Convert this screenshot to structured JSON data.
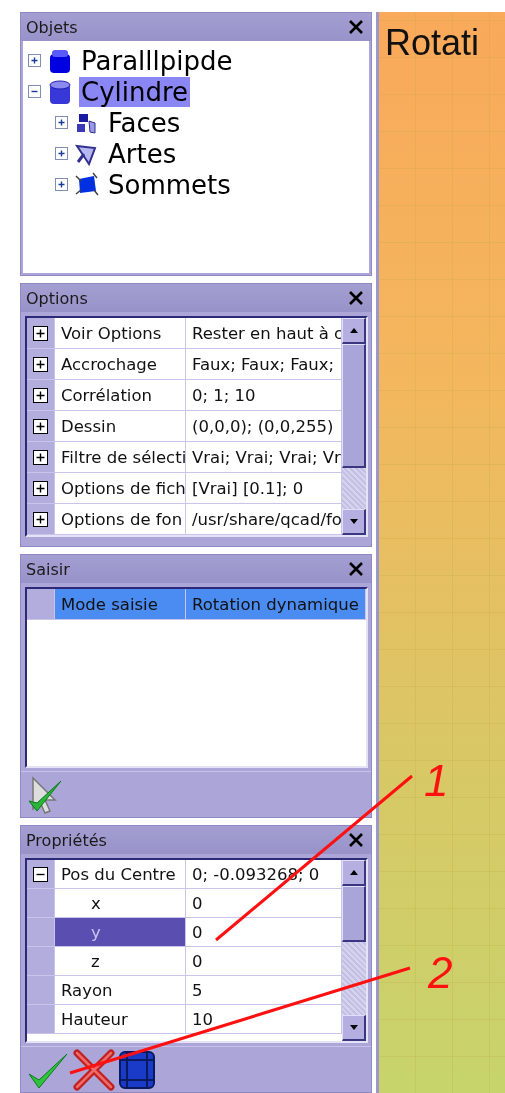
{
  "objects": {
    "title": "Objets",
    "tree": [
      {
        "label": "Paralllpipde",
        "kind": "box",
        "expanded": false,
        "selected": false
      },
      {
        "label": "Cylindre",
        "kind": "cylinder",
        "expanded": true,
        "selected": true,
        "children": [
          {
            "label": "Faces",
            "kind": "faces",
            "expanded": false,
            "selected": false
          },
          {
            "label": "Artes",
            "kind": "edges",
            "expanded": false,
            "selected": false
          },
          {
            "label": "Sommets",
            "kind": "vertices",
            "expanded": false,
            "selected": false
          }
        ]
      }
    ]
  },
  "options": {
    "title": "Options",
    "rows": [
      {
        "name": "Voir Options",
        "value": "Rester en haut à c",
        "expanded": false
      },
      {
        "name": "Accrochage",
        "value": "Faux; Faux; Faux;",
        "expanded": false
      },
      {
        "name": "Corrélation",
        "value": "0; 1; 10",
        "expanded": false
      },
      {
        "name": "Dessin",
        "value": "(0,0,0); (0,0,255)",
        "expanded": false
      },
      {
        "name": "Filtre de sélecti",
        "value": "Vrai; Vrai; Vrai; Vr",
        "expanded": false
      },
      {
        "name": "Options de fich",
        "value": "[Vrai] [0.1]; 0",
        "expanded": false
      },
      {
        "name": "Options de fon",
        "value": "/usr/share/qcad/fo",
        "expanded": false
      }
    ]
  },
  "input": {
    "title": "Saisir",
    "rows": [
      {
        "name": "Mode saisie",
        "value": "Rotation dynamique",
        "selected": true
      }
    ]
  },
  "properties": {
    "title": "Propriétés",
    "rows": [
      {
        "name": "Pos du Centre",
        "value": "0; -0.093268; 0",
        "expanded": true,
        "selected": false,
        "children": [
          {
            "name": "x",
            "value": "0",
            "selected": false
          },
          {
            "name": "y",
            "value": "0",
            "selected": true
          },
          {
            "name": "z",
            "value": "0",
            "selected": false
          }
        ]
      },
      {
        "name": "Rayon",
        "value": "5",
        "selected": false
      },
      {
        "name": "Hauteur",
        "value": "10",
        "selected": false
      }
    ]
  },
  "viewport": {
    "title": "Rotati"
  },
  "annotations": [
    {
      "label": "1"
    },
    {
      "label": "2"
    }
  ]
}
